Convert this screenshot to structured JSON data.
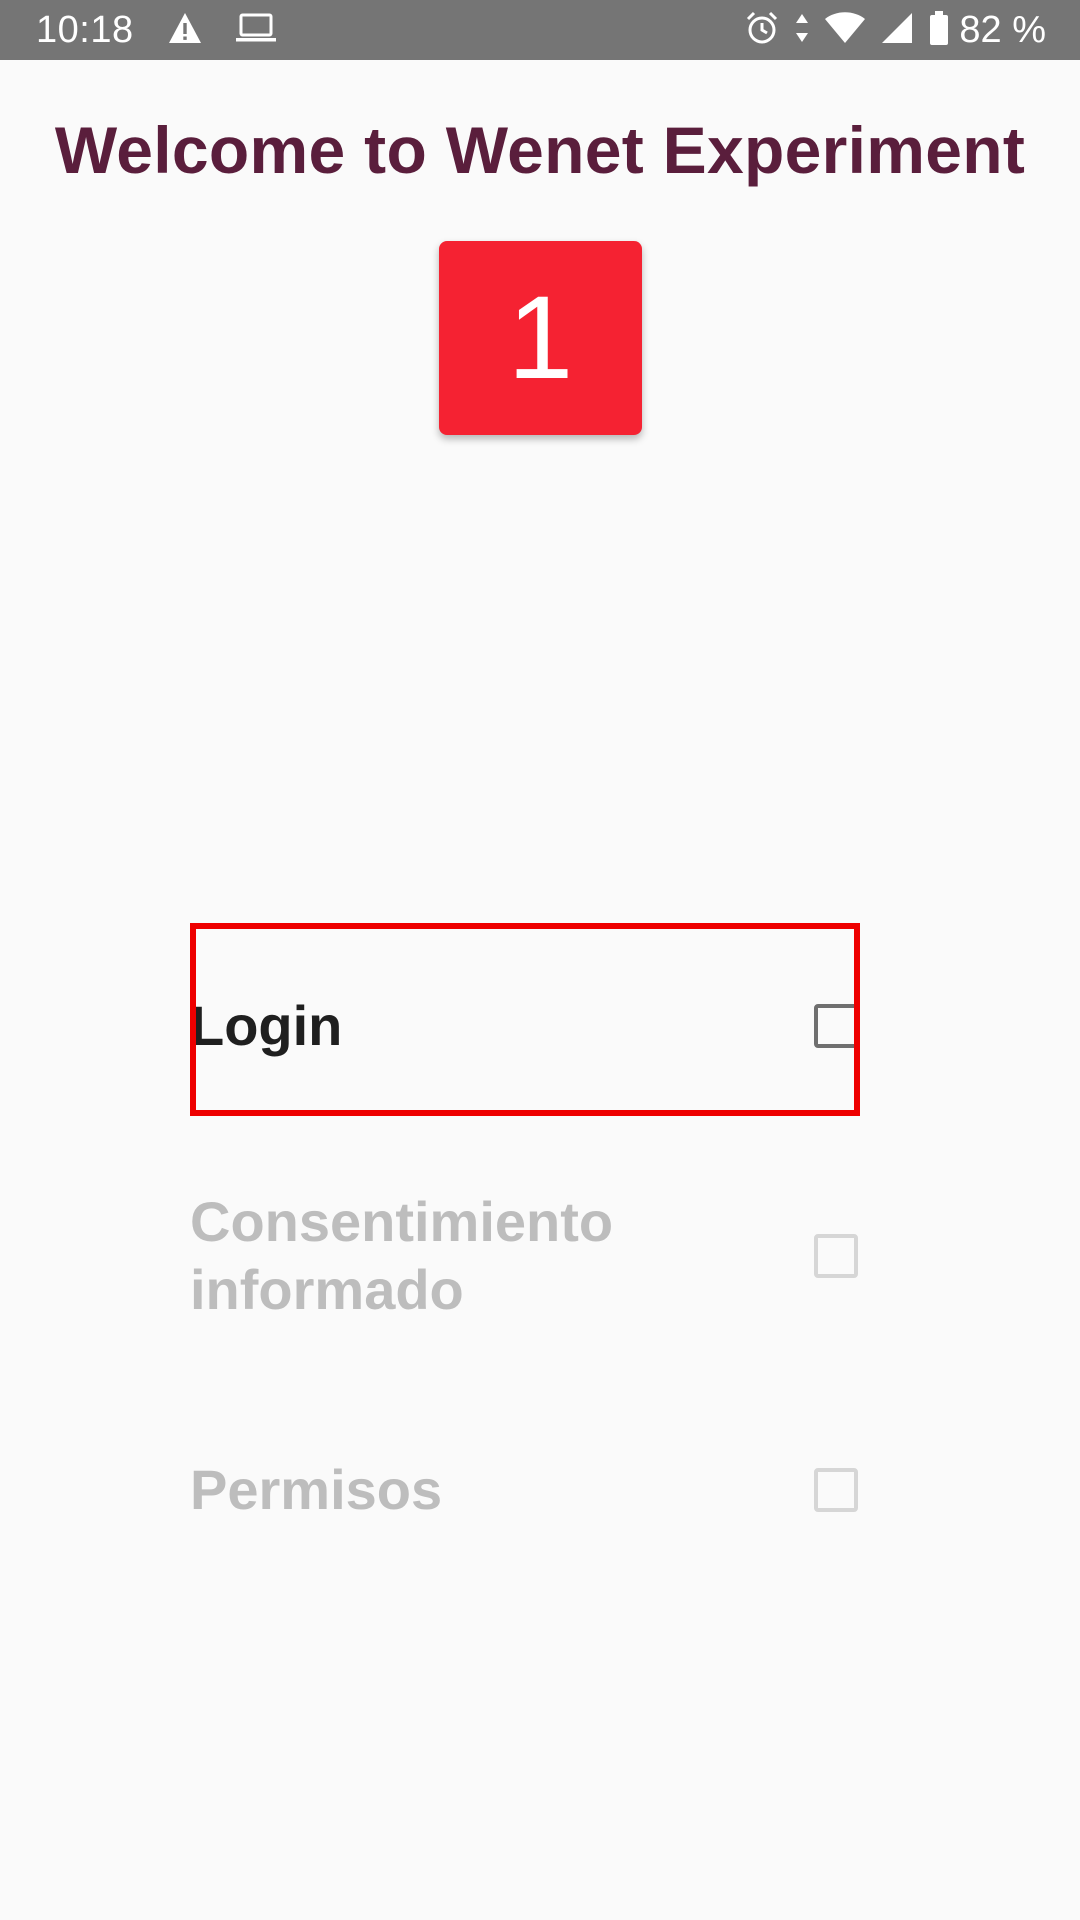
{
  "status_bar": {
    "time": "10:18",
    "left_icons": [
      "warning-icon",
      "laptop-icon"
    ],
    "right_icons": [
      "alarm-icon",
      "data-arrows-icon",
      "wifi-icon",
      "signal-icon",
      "battery-icon"
    ],
    "battery": "82 %",
    "background": "#757575"
  },
  "title": "Welcome to Wenet Experiment",
  "badge": {
    "number": "1",
    "color": "#f52232"
  },
  "steps": [
    {
      "label": "Login",
      "checked": false,
      "state": "active"
    },
    {
      "label": "Consentimiento informado",
      "checked": false,
      "state": "disabled"
    },
    {
      "label": "Permisos",
      "checked": false,
      "state": "disabled"
    }
  ],
  "colors": {
    "title": "#5a1e3c",
    "highlight": "#ee0000",
    "disabled_text": "#bdbdbd"
  }
}
